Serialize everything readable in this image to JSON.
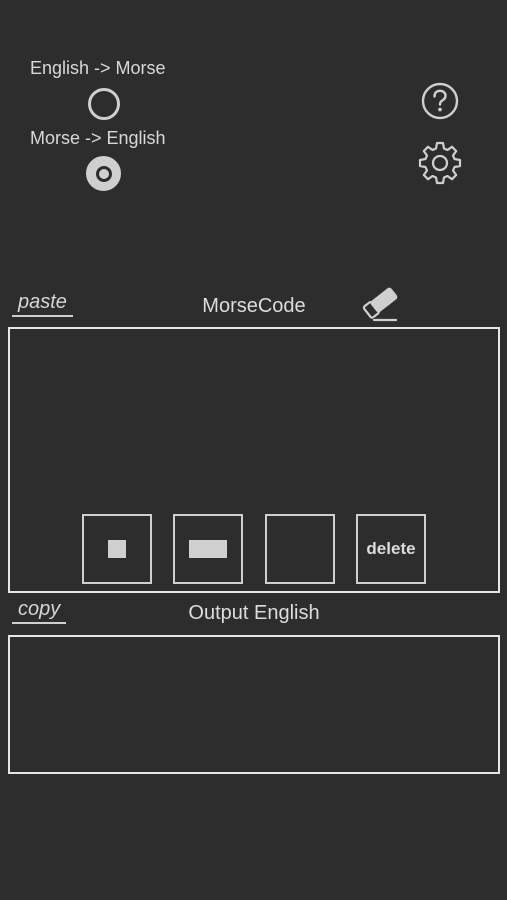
{
  "modes": {
    "english_to_morse": {
      "label": "English -> Morse",
      "selected": false
    },
    "morse_to_english": {
      "label": "Morse -> English",
      "selected": true
    }
  },
  "toolbar": {
    "help_icon": "help-circle-icon",
    "settings_icon": "gear-icon"
  },
  "input_section": {
    "paste_label": "paste",
    "title": "MorseCode",
    "clear_icon": "eraser-icon"
  },
  "keypad": {
    "dot_key": "dot",
    "dash_key": "dash",
    "space_key": "",
    "delete_label": "delete"
  },
  "output_section": {
    "copy_label": "copy",
    "title": "Output English"
  },
  "colors": {
    "background": "#2d2d2d",
    "foreground": "#cfcfcf",
    "panel_border": "#e6e6e6"
  }
}
